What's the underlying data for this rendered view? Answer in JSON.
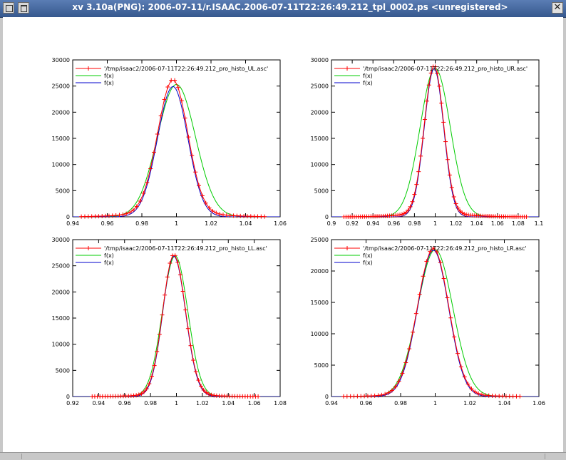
{
  "window": {
    "title": "xv 3.10a(PNG): 2006-07-11/r.ISAAC.2006-07-11T22:26:49.212_tpl_0002.ps <unregistered>",
    "menu_icon": "window-menu-icon",
    "maximize_icon": "maximize-icon",
    "close_icon": "close-icon"
  },
  "chart_data": [
    {
      "type": "line",
      "panel": "UL",
      "title": "",
      "xlabel": "",
      "ylabel": "",
      "xlim": [
        0.94,
        1.06
      ],
      "ylim": [
        0,
        30000
      ],
      "xticks": [
        0.94,
        0.96,
        0.98,
        1,
        1.02,
        1.04,
        1.06
      ],
      "xtick_labels": [
        "0.94",
        "0.96",
        "0.98",
        "1",
        "1.02",
        "1.04",
        "1.06"
      ],
      "yticks": [
        0,
        5000,
        10000,
        15000,
        20000,
        25000,
        30000
      ],
      "ytick_labels": [
        "0",
        "5000",
        "10000",
        "15000",
        "20000",
        "25000",
        "30000"
      ],
      "grid": false,
      "legend_position": "top-left",
      "data_range": [
        0.945,
        1.052
      ],
      "series": [
        {
          "name": "'/tmp/isaac2/2006-07-11T22:26:49.212_pro_histo_UL.asc'",
          "kind": "points",
          "color": "#ff0000",
          "model": {
            "amp": 25500,
            "mu": 0.998,
            "sigL": 0.0088,
            "sigR": 0.0085,
            "wing": 0.03,
            "wingSig": 0.022
          }
        },
        {
          "name": "f(x)",
          "kind": "line",
          "color": "#00cc00",
          "model": {
            "amp": 25300,
            "mu": 1.0,
            "sigL": 0.011,
            "sigR": 0.011
          }
        },
        {
          "name": "f(x)",
          "kind": "line",
          "color": "#0000cc",
          "model": {
            "amp": 24900,
            "mu": 0.998,
            "sigL": 0.0089,
            "sigR": 0.0086
          }
        }
      ]
    },
    {
      "type": "line",
      "panel": "UR",
      "title": "",
      "xlabel": "",
      "ylabel": "",
      "xlim": [
        0.9,
        1.1
      ],
      "ylim": [
        0,
        30000
      ],
      "xticks": [
        0.9,
        0.92,
        0.94,
        0.96,
        0.98,
        1,
        1.02,
        1.04,
        1.06,
        1.08,
        1.1
      ],
      "xtick_labels": [
        "0.9",
        "0.92",
        "0.94",
        "0.96",
        "0.98",
        "1",
        "1.02",
        "1.04",
        "1.06",
        "1.08",
        "1.1"
      ],
      "yticks": [
        0,
        5000,
        10000,
        15000,
        20000,
        25000,
        30000
      ],
      "ytick_labels": [
        "0",
        "5000",
        "10000",
        "15000",
        "20000",
        "25000",
        "30000"
      ],
      "grid": false,
      "legend_position": "top-left",
      "data_range": [
        0.912,
        1.088
      ],
      "series": [
        {
          "name": "'/tmp/isaac2/2006-07-11T22:26:49.212_pro_histo_UR.asc'",
          "kind": "points",
          "color": "#ff0000",
          "model": {
            "amp": 28300,
            "mu": 0.999,
            "sigL": 0.0095,
            "sigR": 0.0092,
            "wing": 0.02,
            "wingSig": 0.03
          }
        },
        {
          "name": "f(x)",
          "kind": "line",
          "color": "#00cc00",
          "model": {
            "amp": 28400,
            "mu": 1.0,
            "sigL": 0.0145,
            "sigR": 0.0145
          }
        },
        {
          "name": "f(x)",
          "kind": "line",
          "color": "#0000cc",
          "model": {
            "amp": 28300,
            "mu": 0.999,
            "sigL": 0.0095,
            "sigR": 0.0092
          }
        }
      ]
    },
    {
      "type": "line",
      "panel": "LL",
      "title": "",
      "xlabel": "",
      "ylabel": "",
      "xlim": [
        0.92,
        1.08
      ],
      "ylim": [
        0,
        30000
      ],
      "xticks": [
        0.92,
        0.94,
        0.96,
        0.98,
        1,
        1.02,
        1.04,
        1.06,
        1.08
      ],
      "xtick_labels": [
        "0.92",
        "0.94",
        "0.96",
        "0.98",
        "1",
        "1.02",
        "1.04",
        "1.06",
        "1.08"
      ],
      "yticks": [
        0,
        5000,
        10000,
        15000,
        20000,
        25000,
        30000
      ],
      "ytick_labels": [
        "0",
        "5000",
        "10000",
        "15000",
        "20000",
        "25000",
        "30000"
      ],
      "grid": false,
      "legend_position": "top-left",
      "data_range": [
        0.935,
        1.063
      ],
      "series": [
        {
          "name": "'/tmp/isaac2/2006-07-11T22:26:49.212_pro_histo_LL.asc'",
          "kind": "points",
          "color": "#ff0000",
          "model": {
            "amp": 26800,
            "mu": 0.998,
            "sigL": 0.0085,
            "sigR": 0.009,
            "wing": 0.012,
            "wingSig": 0.025
          }
        },
        {
          "name": "f(x)",
          "kind": "line",
          "color": "#00cc00",
          "model": {
            "amp": 26900,
            "mu": 0.999,
            "sigL": 0.0098,
            "sigR": 0.0098
          }
        },
        {
          "name": "f(x)",
          "kind": "line",
          "color": "#0000cc",
          "model": {
            "amp": 26800,
            "mu": 0.998,
            "sigL": 0.0085,
            "sigR": 0.009
          }
        }
      ]
    },
    {
      "type": "line",
      "panel": "LR",
      "title": "",
      "xlabel": "",
      "ylabel": "",
      "xlim": [
        0.94,
        1.06
      ],
      "ylim": [
        0,
        25000
      ],
      "xticks": [
        0.94,
        0.96,
        0.98,
        1,
        1.02,
        1.04,
        1.06
      ],
      "xtick_labels": [
        "0.94",
        "0.96",
        "0.98",
        "1",
        "1.02",
        "1.04",
        "1.06"
      ],
      "yticks": [
        0,
        5000,
        10000,
        15000,
        20000,
        25000
      ],
      "ytick_labels": [
        "0",
        "5000",
        "10000",
        "15000",
        "20000",
        "25000"
      ],
      "grid": false,
      "legend_position": "top-left",
      "data_range": [
        0.947,
        1.05
      ],
      "series": [
        {
          "name": "'/tmp/isaac2/2006-07-11T22:26:49.212_pro_histo_LR.asc'",
          "kind": "points",
          "color": "#ff0000",
          "model": {
            "amp": 23300,
            "mu": 0.999,
            "sigL": 0.0092,
            "sigR": 0.0088,
            "wing": 0.015,
            "wingSig": 0.022
          }
        },
        {
          "name": "f(x)",
          "kind": "line",
          "color": "#00cc00",
          "model": {
            "amp": 23400,
            "mu": 1.0,
            "sigL": 0.0102,
            "sigR": 0.0102
          }
        },
        {
          "name": "f(x)",
          "kind": "line",
          "color": "#0000cc",
          "model": {
            "amp": 23300,
            "mu": 0.999,
            "sigL": 0.0092,
            "sigR": 0.0088
          }
        }
      ]
    }
  ]
}
